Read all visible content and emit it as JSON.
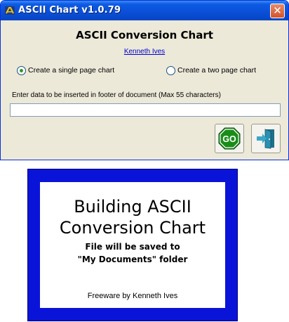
{
  "window": {
    "title": "ASCII Chart v1.0.79",
    "close_glyph": "✕",
    "icon": "app-icon"
  },
  "main": {
    "heading": "ASCII Conversion Chart",
    "author_link": "Kenneth Ives",
    "options": [
      {
        "label": "Create a single page chart",
        "selected": true
      },
      {
        "label": "Create a two page chart",
        "selected": false
      }
    ],
    "footer_field": {
      "label": "Enter data to be inserted in footer of document (Max 55 characters)",
      "value": ""
    },
    "go_button": {
      "label": "GO",
      "icon": "go-sign-icon",
      "color": "#1a8c1a"
    },
    "exit_button": {
      "icon": "exit-door-icon",
      "color": "#2a8fb0"
    }
  },
  "splash": {
    "title_line1": "Building ASCII",
    "title_line2": "Conversion Chart",
    "message_line1": "File will be saved to",
    "message_line2": "\"My Documents\" folder",
    "credit": "Freeware by Kenneth Ives",
    "border_color": "#0a14d8"
  }
}
